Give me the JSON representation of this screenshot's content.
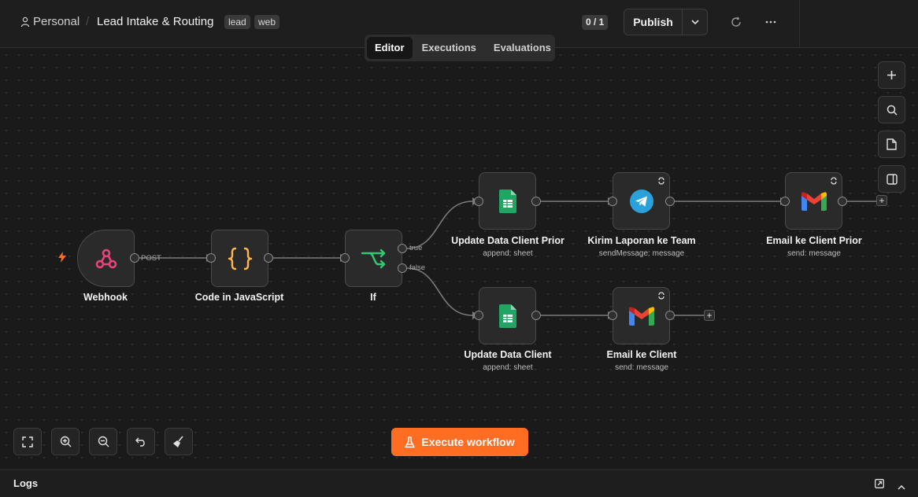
{
  "header": {
    "project": "Personal",
    "separator": "/",
    "workflow_title": "Lead Intake & Routing",
    "tags": [
      "lead",
      "web"
    ],
    "version_counter": "0 / 1",
    "publish_label": "Publish"
  },
  "tabs": [
    {
      "label": "Editor",
      "active": true
    },
    {
      "label": "Executions",
      "active": false
    },
    {
      "label": "Evaluations",
      "active": false
    }
  ],
  "nodes": {
    "webhook": {
      "label": "Webhook",
      "icon": "webhook-icon"
    },
    "code": {
      "label": "Code in JavaScript",
      "icon": "code-braces-icon"
    },
    "if": {
      "label": "If",
      "icon": "branch-icon"
    },
    "update_prior": {
      "label": "Update Data Client Prior",
      "sub": "append: sheet",
      "icon": "google-sheets-icon"
    },
    "telegram": {
      "label": "Kirim Laporan ke Team",
      "sub": "sendMessage: message",
      "icon": "telegram-icon"
    },
    "email_prior": {
      "label": "Email ke Client Prior",
      "sub": "send: message",
      "icon": "gmail-icon"
    },
    "update_client": {
      "label": "Update Data Client",
      "sub": "append: sheet",
      "icon": "google-sheets-icon"
    },
    "email_client": {
      "label": "Email ke Client",
      "sub": "send: message",
      "icon": "gmail-icon"
    }
  },
  "edge_labels": {
    "webhook_out": "POST",
    "if_true": "true",
    "if_false": "false"
  },
  "execute_label": "Execute workflow",
  "logs_label": "Logs",
  "colors": {
    "accent": "#ff6d22",
    "canvas": "#1a1a1a",
    "sheets_green": "#21a464",
    "telegram_blue": "#2aa1da",
    "webhook_pink": "#e5457a",
    "code_orange": "#ffb84d",
    "if_green": "#2ecc71"
  }
}
